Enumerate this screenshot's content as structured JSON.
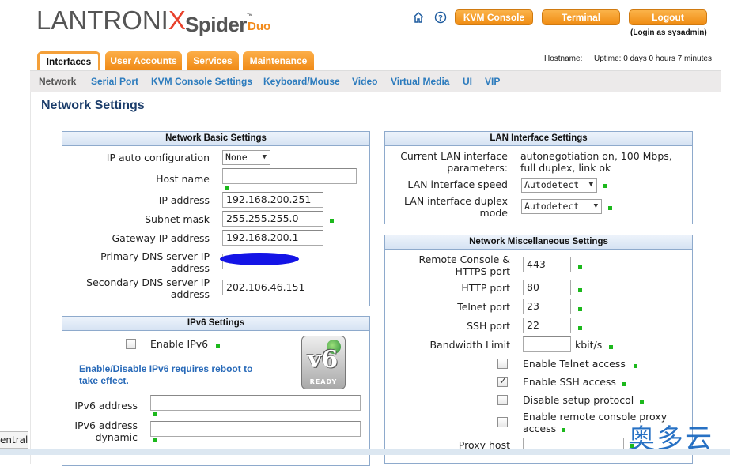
{
  "header": {
    "logo_main": "LANTRONI",
    "logo_x": "X",
    "product_name": "Spider",
    "product_suffix": "Duo",
    "product_tm": "™",
    "home_icon": "home-icon",
    "help_icon": "help-icon",
    "kvm_console_label": "KVM Console",
    "terminal_label": "Terminal",
    "logout_label": "Logout",
    "login_as": "(Login as sysadmin)",
    "brand_orange": "#f39c2b",
    "brand_blue": "#2c7bbd"
  },
  "tabs": [
    {
      "label": "Interfaces",
      "active": true
    },
    {
      "label": "User Accounts",
      "active": false
    },
    {
      "label": "Services",
      "active": false
    },
    {
      "label": "Maintenance",
      "active": false
    }
  ],
  "status": {
    "hostname_label": "Hostname:",
    "uptime": "Uptime: 0 days 0 hours 7 minutes"
  },
  "subnav": [
    {
      "label": "Network",
      "current": true
    },
    {
      "label": "Serial Port"
    },
    {
      "label": "KVM Console Settings"
    },
    {
      "label": "Keyboard/Mouse"
    },
    {
      "label": "Video"
    },
    {
      "label": "Virtual Media"
    },
    {
      "label": "UI"
    },
    {
      "label": "VIP"
    }
  ],
  "page_title": "Network Settings",
  "basic": {
    "title": "Network Basic Settings",
    "ip_auto_label": "IP auto configuration",
    "ip_auto_value": "None",
    "host_name_label": "Host name",
    "host_name_value": "",
    "ip_address_label": "IP address",
    "ip_address_value": "192.168.200.251",
    "subnet_label": "Subnet mask",
    "subnet_value": "255.255.255.0",
    "gateway_label": "Gateway IP address",
    "gateway_value": "192.168.200.1",
    "primary_dns_label_1": "Primary DNS server IP",
    "primary_dns_label_2": "address",
    "secondary_dns_label_1": "Secondary DNS server IP",
    "secondary_dns_label_2": "address",
    "secondary_dns_value": "202.106.46.151"
  },
  "ipv6": {
    "title": "IPv6 Settings",
    "enable_label": "Enable IPv6",
    "enabled": false,
    "note_1": "Enable/Disable IPv6 requires reboot to",
    "note_2": "take effect.",
    "address_label": "IPv6 address",
    "address_value": "",
    "dynamic_label_1": "IPv6 address",
    "dynamic_label_2": "dynamic",
    "dynamic_value": "",
    "badge_text": "READY"
  },
  "lan": {
    "title": "LAN Interface Settings",
    "current_label_1": "Current LAN interface",
    "current_label_2": "parameters:",
    "current_value_1": "autonegotiation on, 100 Mbps,",
    "current_value_2": "full duplex, link ok",
    "speed_label": "LAN interface speed",
    "speed_value": "Autodetect",
    "duplex_label_1": "LAN interface duplex",
    "duplex_label_2": "mode",
    "duplex_value": "Autodetect"
  },
  "misc": {
    "title": "Network Miscellaneous Settings",
    "rc_https_label_1": "Remote Console &",
    "rc_https_label_2": "HTTPS port",
    "rc_https_value": "443",
    "http_label": "HTTP port",
    "http_value": "80",
    "telnet_label": "Telnet port",
    "telnet_value": "23",
    "ssh_label": "SSH port",
    "ssh_value": "22",
    "bandwidth_label": "Bandwidth Limit",
    "bandwidth_value": "",
    "bandwidth_unit": "kbit/s",
    "enable_telnet_label": "Enable Telnet access",
    "enable_telnet": false,
    "enable_ssh_label": "Enable SSH access",
    "enable_ssh": true,
    "disable_setup_label": "Disable setup protocol",
    "disable_setup": false,
    "remote_proxy_label_1": "Enable remote console proxy",
    "remote_proxy_label_2": "access",
    "remote_proxy": false,
    "proxy_host_label": "Proxy host"
  },
  "bottom_tab_text": "entral/",
  "watermark": "奥多云"
}
